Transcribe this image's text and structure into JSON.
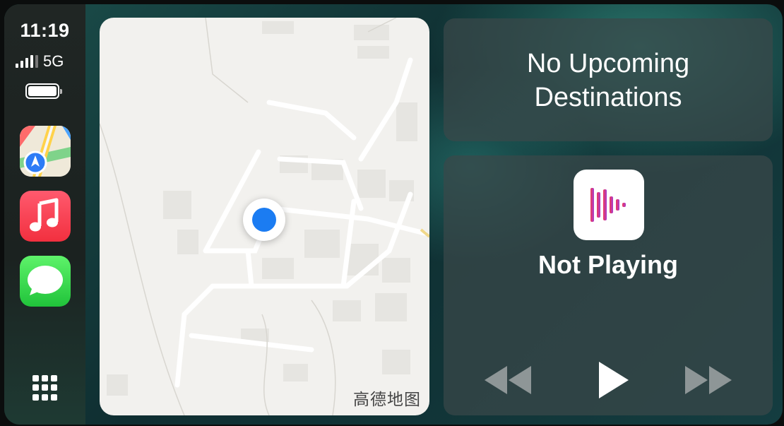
{
  "status": {
    "time": "11:19",
    "network": "5G",
    "signal_level": 4
  },
  "sidebar": {
    "apps": [
      {
        "name": "Maps",
        "icon": "maps-icon"
      },
      {
        "name": "Music",
        "icon": "music-note-icon"
      },
      {
        "name": "Messages",
        "icon": "speech-bubble-icon"
      }
    ],
    "grid_icon": "app-grid-icon"
  },
  "map": {
    "brand": "高德地图"
  },
  "destinations": {
    "line1": "No Upcoming",
    "line2": "Destinations"
  },
  "now_playing": {
    "status": "Not Playing",
    "icon": "audio-waveform-icon"
  },
  "controls": [
    "rewind-icon",
    "play-icon",
    "fast-forward-icon"
  ],
  "colors": {
    "accent_blue": "#1b7cf2",
    "music_red": "#f2303f",
    "messages_green": "#20c33a"
  }
}
